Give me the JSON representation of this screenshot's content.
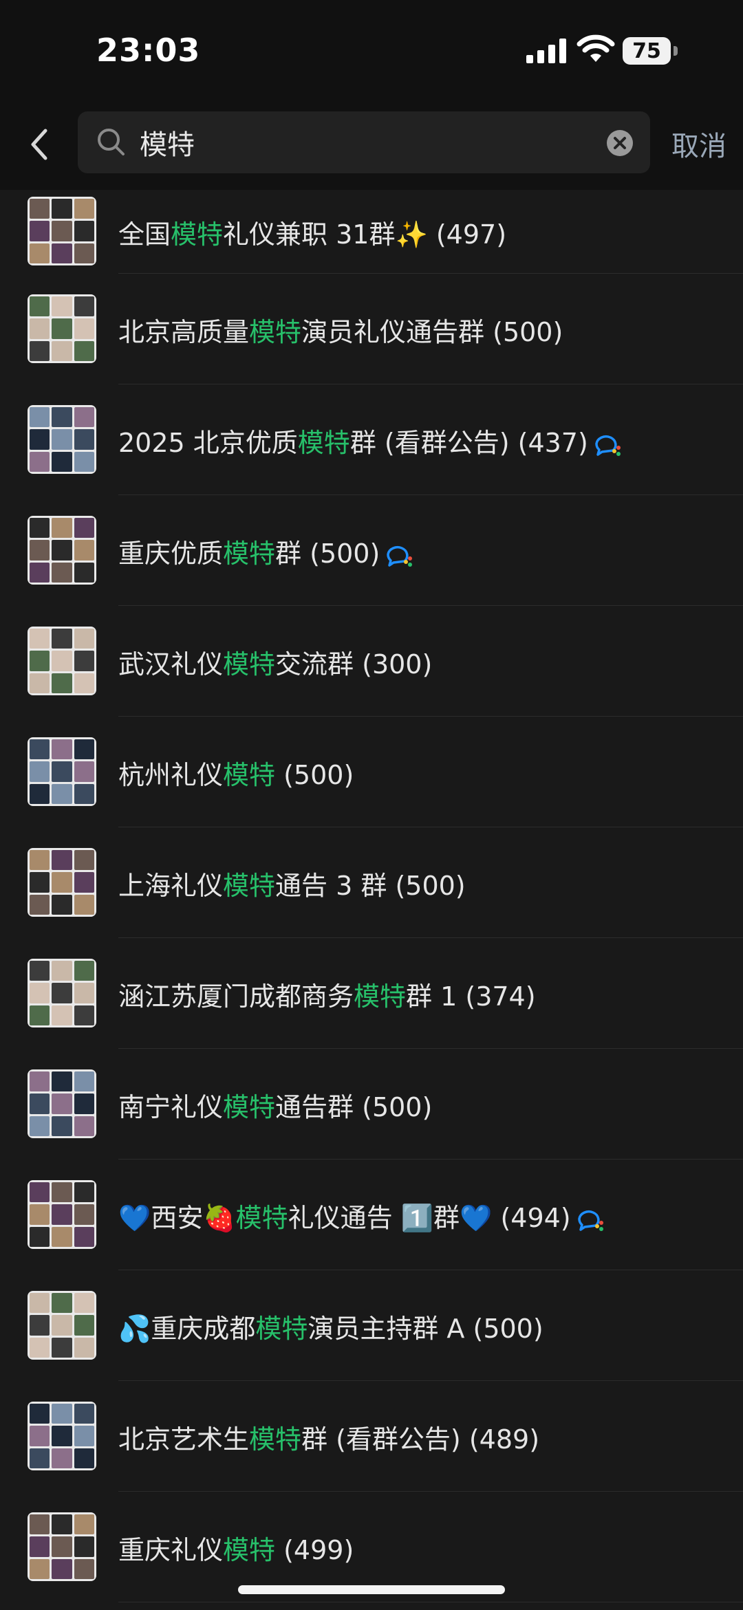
{
  "status_bar": {
    "time": "23:03",
    "battery": "75"
  },
  "search": {
    "query": "模特",
    "cancel_label": "取消"
  },
  "results": [
    {
      "pre": "全国",
      "hl": "模特",
      "post": "礼仪兼职 31群✨",
      "count": "(497)",
      "ai": false
    },
    {
      "pre": "北京高质量",
      "hl": "模特",
      "post": "演员礼仪通告群",
      "count": "(500)",
      "ai": false
    },
    {
      "pre": "2025 北京优质",
      "hl": "模特",
      "post": "群 (看群公告)",
      "count": "(437)",
      "ai": true
    },
    {
      "pre": "重庆优质",
      "hl": "模特",
      "post": "群",
      "count": "(500)",
      "ai": true
    },
    {
      "pre": "武汉礼仪",
      "hl": "模特",
      "post": "交流群",
      "count": "(300)",
      "ai": false
    },
    {
      "pre": "杭州礼仪",
      "hl": "模特",
      "post": "",
      "count": "(500)",
      "ai": false
    },
    {
      "pre": "上海礼仪",
      "hl": "模特",
      "post": "通告 3 群",
      "count": "(500)",
      "ai": false
    },
    {
      "pre": "涵江苏厦门成都商务",
      "hl": "模特",
      "post": "群 1",
      "count": "(374)",
      "ai": false
    },
    {
      "pre": "南宁礼仪",
      "hl": "模特",
      "post": "通告群",
      "count": "(500)",
      "ai": false
    },
    {
      "pre": "💙西安🍓",
      "hl": "模特",
      "post": "礼仪通告 1️⃣群💙",
      "count": "(494)",
      "ai": true
    },
    {
      "pre": "💦重庆成都",
      "hl": "模特",
      "post": "演员主持群 A",
      "count": "(500)",
      "ai": false
    },
    {
      "pre": "北京艺术生",
      "hl": "模特",
      "post": "群 (看群公告)",
      "count": "(489)",
      "ai": false
    },
    {
      "pre": "重庆礼仪",
      "hl": "模特",
      "post": "",
      "count": "(499)",
      "ai": false
    }
  ],
  "colors": {
    "highlight": "#27c06a",
    "background": "#191919",
    "header": "#111111"
  },
  "icons": [
    "back-arrow-icon",
    "search-icon",
    "clear-icon",
    "ai-summary-icon"
  ]
}
